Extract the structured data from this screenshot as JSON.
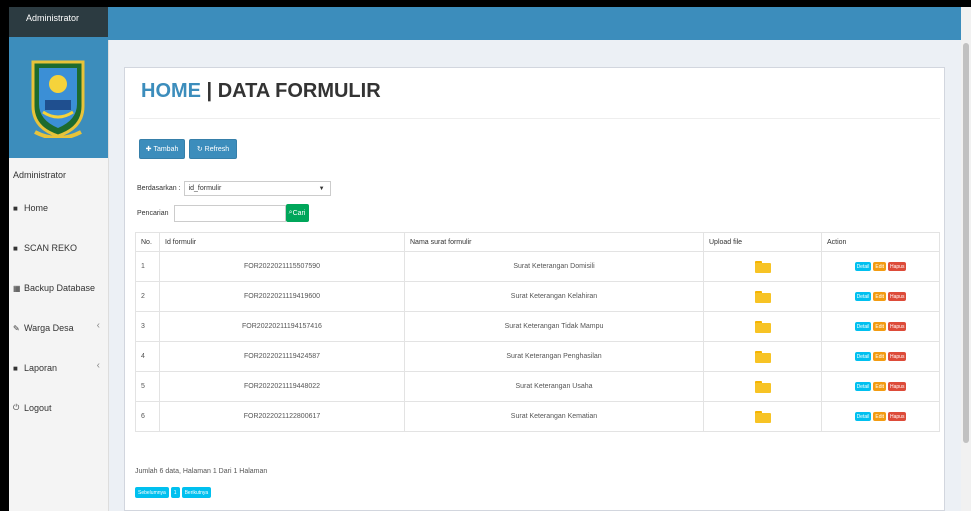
{
  "brand": "Administrator",
  "sidebar": {
    "user": "Administrator",
    "items": [
      {
        "icon": "home-icon",
        "glyph": "■",
        "label": "Home"
      },
      {
        "icon": "scan-icon",
        "glyph": "■",
        "label": "SCAN REKO"
      },
      {
        "icon": "database-icon",
        "glyph": "▦",
        "label": "Backup Database"
      },
      {
        "icon": "edit-icon",
        "glyph": "✎",
        "label": "Warga Desa"
      },
      {
        "icon": "book-icon",
        "glyph": "■",
        "label": "Laporan"
      },
      {
        "icon": "logout-icon",
        "glyph": "⏻",
        "label": "Logout"
      }
    ]
  },
  "page": {
    "title_home": "HOME",
    "title_sep": " | ",
    "title_rest": "DATA FORMULIR",
    "tambah_label": "Tambah",
    "refresh_label": "Refresh",
    "filter_label": "Berdasarkan :",
    "filter_value": "id_formulir",
    "search_label": "Pencarian",
    "search_value": "",
    "cari_label": "Cari"
  },
  "table": {
    "columns": [
      "No.",
      "Id formulir",
      "Nama surat formulir",
      "Upload file",
      "Action"
    ],
    "rows": [
      {
        "no": "1",
        "id": "FOR2022021115507590",
        "nama": "Surat Keterangan Domisili"
      },
      {
        "no": "2",
        "id": "FOR2022021119419600",
        "nama": "Surat Keterangan Kelahiran"
      },
      {
        "no": "3",
        "id": "FOR20220211194157416",
        "nama": "Surat Keterangan Tidak Mampu"
      },
      {
        "no": "4",
        "id": "FOR2022021119424587",
        "nama": "Surat Keterangan Penghasilan"
      },
      {
        "no": "5",
        "id": "FOR2022021119448022",
        "nama": "Surat Keterangan Usaha"
      },
      {
        "no": "6",
        "id": "FOR2022021122800617",
        "nama": "Surat Keterangan Kematian"
      }
    ],
    "action_labels": {
      "detail": "Detail",
      "edit": "Edit",
      "hapus": "Hapus"
    }
  },
  "footer": {
    "summary": "Jumlah 6 data, Halaman 1 Dari 1 Halaman",
    "prev_label": "Sebelumnya",
    "page_label": "1",
    "next_label": "Berikutnya"
  },
  "colors": {
    "primary": "#3c8dbc",
    "success": "#00a65a",
    "info": "#00c0ef",
    "warning": "#f39c12",
    "danger": "#dd4b39"
  }
}
